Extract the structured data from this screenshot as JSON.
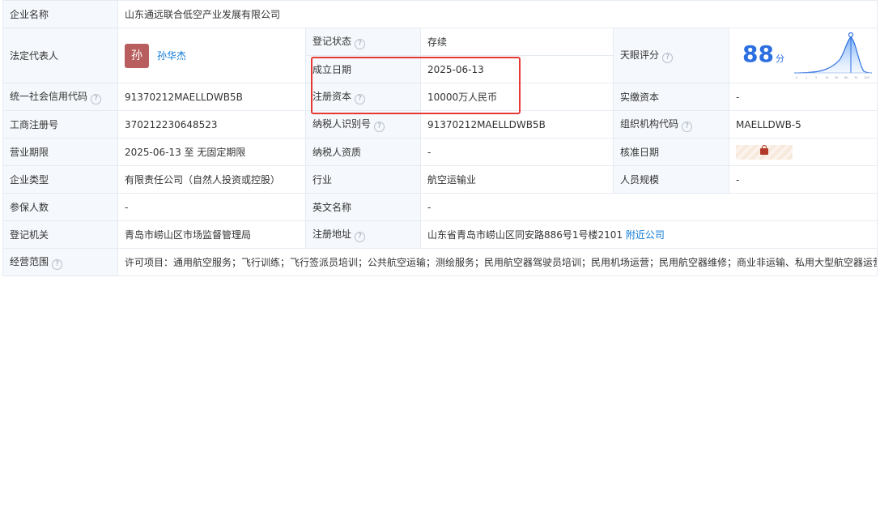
{
  "company": {
    "label": "企业名称",
    "value": "山东通远联合低空产业发展有限公司"
  },
  "legal_rep": {
    "label": "法定代表人",
    "avatar_char": "孙",
    "name": "孙华杰"
  },
  "reg_status": {
    "label": "登记状态",
    "value": "存续"
  },
  "tianyan": {
    "label": "天眼评分",
    "score": "88",
    "unit": "分",
    "ticks": [
      "0",
      "1",
      "5",
      "15",
      "30",
      "60",
      "75",
      "100"
    ]
  },
  "est_date": {
    "label": "成立日期",
    "value": "2025-06-13"
  },
  "credit_code": {
    "label": "统一社会信用代码",
    "value": "91370212MAELLDWB5B"
  },
  "reg_capital": {
    "label": "注册资本",
    "value": "10000万人民币"
  },
  "paid_capital": {
    "label": "实缴资本",
    "value": "-"
  },
  "biz_reg_no": {
    "label": "工商注册号",
    "value": "370212230648523"
  },
  "taxpayer_id": {
    "label": "纳税人识别号",
    "value": "91370212MAELLDWB5B"
  },
  "org_code": {
    "label": "组织机构代码",
    "value": "MAELLDWB-5"
  },
  "term": {
    "label": "营业期限",
    "value": "2025-06-13 至 无固定期限"
  },
  "taxpayer_qual": {
    "label": "纳税人资质",
    "value": "-"
  },
  "approval_date": {
    "label": "核准日期"
  },
  "company_type": {
    "label": "企业类型",
    "value": "有限责任公司（自然人投资或控股）"
  },
  "industry": {
    "label": "行业",
    "value": "航空运输业"
  },
  "staff_size": {
    "label": "人员规模",
    "value": "-"
  },
  "insured": {
    "label": "参保人数",
    "value": "-"
  },
  "english_name": {
    "label": "英文名称",
    "value": "-"
  },
  "reg_authority": {
    "label": "登记机关",
    "value": "青岛市崂山区市场监督管理局"
  },
  "reg_address": {
    "label": "注册地址",
    "value": "山东省青岛市崂山区同安路886号1号楼2101",
    "link": "附近公司"
  },
  "scope": {
    "label": "经营范围",
    "value": "许可项目：通用航空服务；飞行训练；飞行签派员培训；公共航空运输；测绘服务；民用航空器驾驶员培训；民用机场运营；民用航空器维修；商业非运输、私用大型航空器运营人、航空器代管人运行业务；民用航空维修人员培训；安全生产检验检测；检验检测服务；建设工程质量检测；省际普通货船运输、省内船舶运输；公共铁路运输；道路货物运输（不含危险货物）。（依法须经批准的项目，经相关部门批准后方可开展经营活动，具体经营项目以相关部门批准文件或许可证件为准）一般项目：智能无人飞行器制造；智能无人飞行器销售；航空运输设备销售；信息系统集成服务；交通安全、管制专用设备制造；智能机器人的研发；导航、测绘、气象及海洋专用仪器销售；信息系统运行维护服务；海洋服务；航空商务服务；航空运营支持服务；国内货物运输代理；地理遥感信息服务；卫星通信服务；卫星遥感应用系统集成；紧急救援服务；业务培训（不含教育培训、职业技能培训等需取得许可的培训）；技术服务、技术开发、技术咨询、技术交流、技术转让、技术推广；网络技术服务；物联网技术服务；5G通信技术服务；信息技术咨询服务；卫星技术综合应用系统集成；人工智能基础资源与技术平台；人工智能应用软件开发；人工智能公共服务平台技术咨询服务；工程技术服务（规划管理、勘察、设计、监理除外）；气象信息服务；信息咨询服务（不含许可类信息咨询服务）；信息安全设备销售；网络与信息安全软件开发；数据处理和存储支持服务；数据处理服务；环境保护监测；海洋环境服务；气象观测服务；专用仪器制造；信息安全设备制造；环境卫生管理（不含环境质量监测、污染源检查、城市生活垃圾、建筑垃圾、餐厨垃圾的处置服务）；铁路运输辅助活动；水文服务；互联网安全服务；民用航空材料销售；运输货物打包服务；道路货物运输站经营；航空运输货物打包服务；国内集装箱货物运输代理；装卸搬运；人工智能硬件销售；人工智能公共数据平台；人工智能行业应用系统集成服务；计算机系统服务；计算机软硬件及辅助设备零售；计算机软硬件及辅助设备批发；咨询策划服务；会议及展览服务；林业有害生物防治服务；农作物病虫害防治服务；安全系统监控服务；安全技术防范系统设计施工服务；特种设备出租；体育赛事策划；体育竞赛组织；体育用品及器材制造；组织体育表演活动；体育场地设施经营（不含高危险性体育运动）；体育用品及器材零售；电影摄制服务；专业设计服务；服装服饰零售；以自有资金从事投资活动；园区管理服务；软件开发；人工智能基础软件开发。（除依法须经批准的项目外，凭营业执照依法自主开展经营活动）"
  },
  "colors": {
    "label_bg": "#f5f8fc",
    "border": "#e6ebf2",
    "link": "#0a78d6",
    "status_green": "#22a745",
    "score_blue": "#2c6fe0",
    "highlight": "#e53935"
  }
}
